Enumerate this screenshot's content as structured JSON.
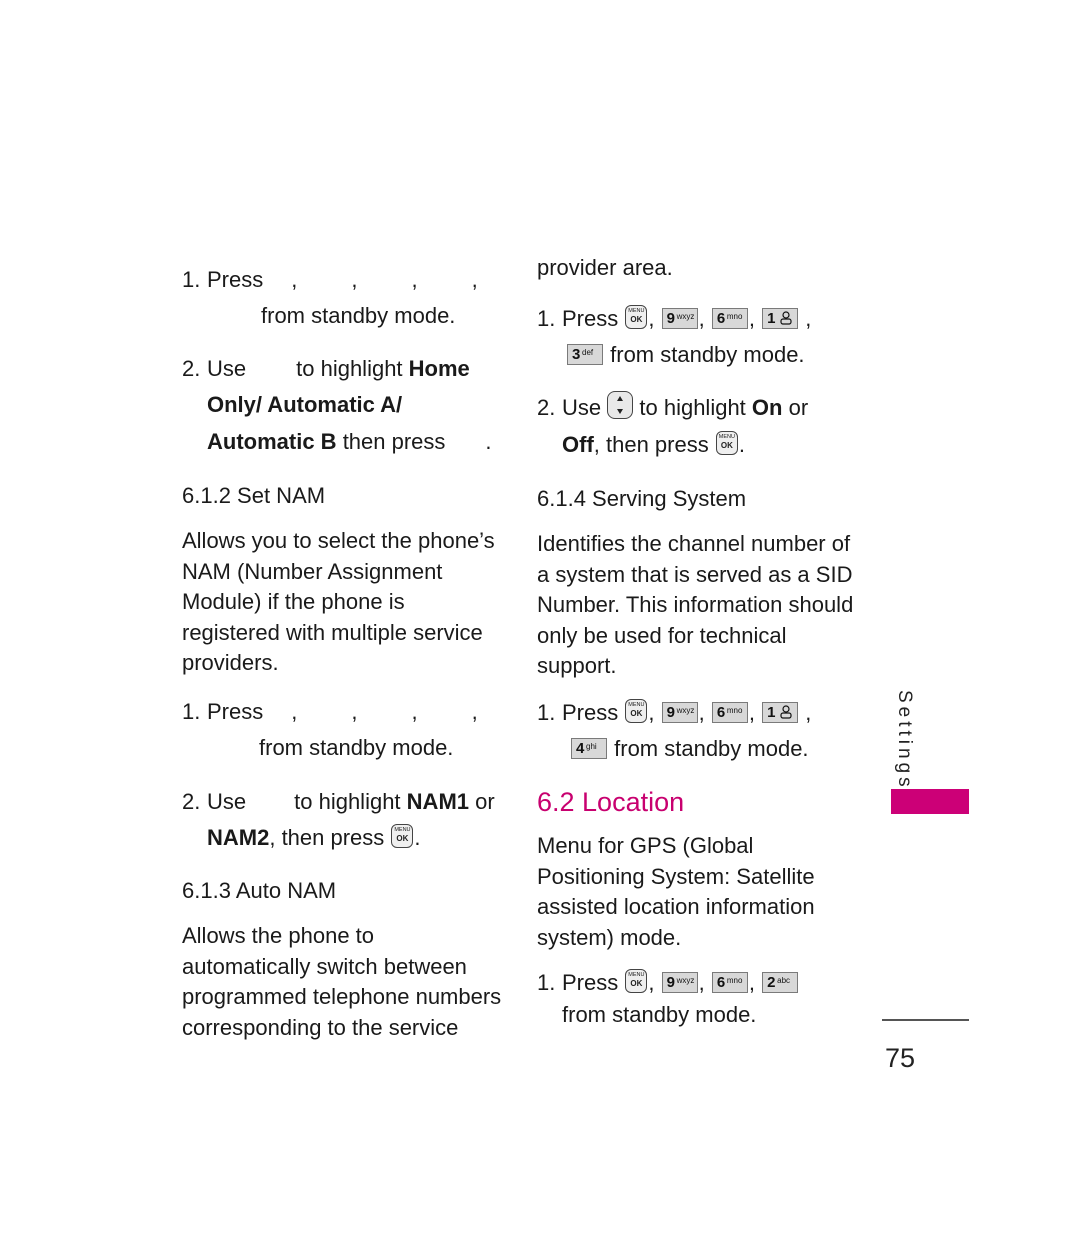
{
  "page": {
    "number": "75",
    "section_tab": "Settings",
    "accent_color": "#cc0077"
  },
  "left": {
    "step1a": {
      "num": "1.",
      "prefix": "Press",
      "commas": [
        ",",
        ",",
        ",",
        ","
      ],
      "suffix": "from standby mode."
    },
    "step2a": {
      "num": "2.",
      "prefix": "Use",
      "middle": "to highlight",
      "b1": "Home",
      "b2": "Only/ Automatic A/",
      "b3": "Automatic B",
      "tail": "then press",
      "end": "."
    },
    "set_nam": {
      "heading": "6.1.2 Set NAM",
      "body": [
        "Allows you to select the phone’s",
        "NAM (Number Assignment",
        "Module) if the phone is",
        "registered with multiple service",
        "providers."
      ],
      "step1": {
        "num": "1.",
        "prefix": "Press",
        "commas": [
          ",",
          ",",
          ",",
          ","
        ],
        "suffix": "from standby mode."
      },
      "step2": {
        "num": "2.",
        "prefix": "Use",
        "middle": "to highlight",
        "b1": "NAM1",
        "or": "or",
        "b2": "NAM2",
        "tail": ", then press",
        "end": "."
      }
    },
    "auto_nam": {
      "heading": "6.1.3 Auto NAM",
      "body": [
        "Allows the phone to",
        "automatically switch between",
        "programmed telephone numbers",
        "corresponding to the service"
      ]
    }
  },
  "right": {
    "continued": "provider area.",
    "step1": {
      "num": "1.",
      "prefix": "Press",
      "keys": [
        {
          "type": "menu",
          "top": "MENU",
          "bottom": "OK"
        },
        {
          "type": "key",
          "digit": "9",
          "letters": "wxyz"
        },
        {
          "type": "key",
          "digit": "6",
          "letters": "mno"
        },
        {
          "type": "key",
          "digit": "1",
          "letters": "voicemail-icon"
        },
        {
          "type": "key",
          "digit": "3",
          "letters": "def"
        }
      ],
      "comma": ",",
      "suffix": "from standby mode."
    },
    "step2": {
      "num": "2.",
      "prefix": "Use",
      "middle": "to highlight",
      "b1": "On",
      "or": "or",
      "b2": "Off",
      "tail": ", then press",
      "end": "."
    },
    "serving_system": {
      "heading": "6.1.4 Serving System",
      "body": [
        "Identifies the channel number of",
        "a system that is served as a SID",
        "Number. This information should",
        "only be used for technical",
        "support."
      ],
      "step1": {
        "num": "1.",
        "prefix": "Press",
        "keys": [
          {
            "type": "menu",
            "top": "MENU",
            "bottom": "OK"
          },
          {
            "type": "key",
            "digit": "9",
            "letters": "wxyz"
          },
          {
            "type": "key",
            "digit": "6",
            "letters": "mno"
          },
          {
            "type": "key",
            "digit": "1",
            "letters": "voicemail-icon"
          },
          {
            "type": "key",
            "digit": "4",
            "letters": "ghi"
          }
        ],
        "comma": ",",
        "suffix": "from standby mode."
      }
    },
    "location": {
      "heading": "6.2 Location",
      "body": [
        "Menu for GPS (Global",
        "Positioning System: Satellite",
        "assisted location information",
        "system) mode."
      ],
      "step1": {
        "num": "1.",
        "prefix": "Press",
        "keys": [
          {
            "type": "menu",
            "top": "MENU",
            "bottom": "OK"
          },
          {
            "type": "key",
            "digit": "9",
            "letters": "wxyz"
          },
          {
            "type": "key",
            "digit": "6",
            "letters": "mno"
          },
          {
            "type": "key",
            "digit": "2",
            "letters": "abc"
          }
        ],
        "comma": ",",
        "suffix": "from standby mode."
      }
    }
  }
}
